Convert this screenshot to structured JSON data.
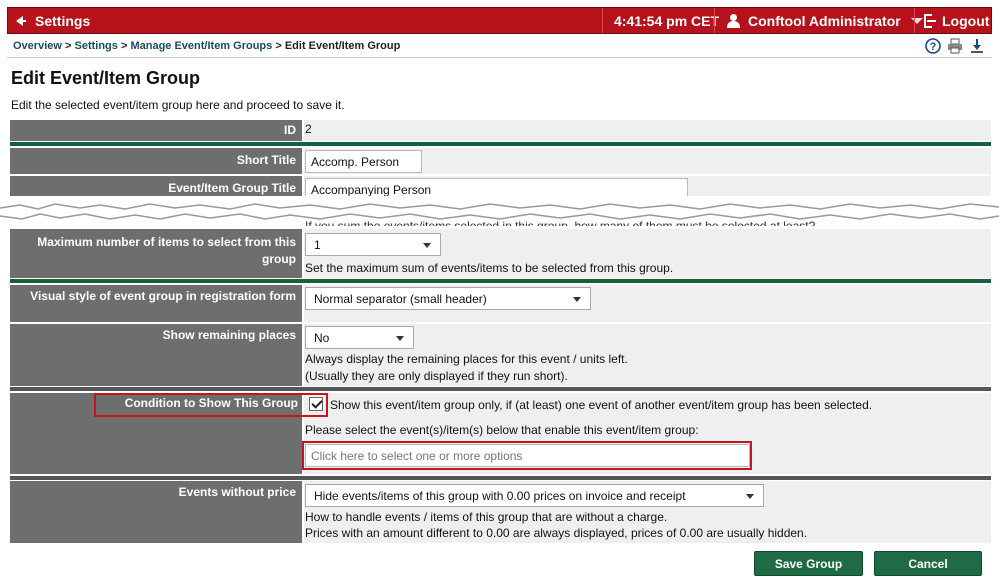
{
  "topbar": {
    "settings_label": "Settings",
    "time": "4:41:54 pm CET",
    "user": "Conftool Administrator",
    "logout_label": "Logout"
  },
  "breadcrumb": {
    "items": [
      "Overview",
      "Settings",
      "Manage Event/Item Groups"
    ],
    "separator": ">",
    "current": "Edit Event/Item Group"
  },
  "page": {
    "title": "Edit Event/Item Group",
    "description": "Edit the selected event/item group here and proceed to save it."
  },
  "form": {
    "id": {
      "label": "ID",
      "value": "2"
    },
    "short_title": {
      "label": "Short Title",
      "value": "Accomp. Person"
    },
    "group_title": {
      "label": "Event/Item Group Title",
      "value": "Accompanying Person"
    },
    "min_hint_fragment": "If you sum the events/items selected in this group, how many of them must be selected at least?",
    "max_items": {
      "label": "Maximum number of items to select from this group",
      "value": "1",
      "hint": "Set the maximum sum of events/items to be selected from this group."
    },
    "visual_style": {
      "label": "Visual style of event group in registration form",
      "value": "Normal separator (small header)"
    },
    "remaining": {
      "label": "Show remaining places",
      "value": "No",
      "hint_line1": "Always display the remaining places for this event / units left.",
      "hint_line2": "(Usually they are only displayed if they run short)."
    },
    "condition": {
      "label": "Condition to Show This Group",
      "checkbox_text": "Show this event/item group only, if (at least) one event of another event/item group has been selected.",
      "select_prompt": "Please select the event(s)/item(s) below that enable this event/item group:",
      "multiselect_placeholder": "Click here to select one or more options",
      "checked": true
    },
    "events_without_price": {
      "label": "Events without price",
      "value": "Hide events/items of this group with 0.00 prices on invoice and receipt",
      "hint_line1": "How to handle events / items of this group that are without a charge.",
      "hint_line2": "Prices with an amount different to 0.00 are always displayed, prices of 0.00 are usually hidden."
    }
  },
  "buttons": {
    "save": "Save Group",
    "cancel": "Cancel"
  },
  "colors": {
    "topbar": "#b5121b",
    "label_bg": "#6e6e6e",
    "accent_green": "#17603a",
    "highlight": "#c4161c"
  }
}
